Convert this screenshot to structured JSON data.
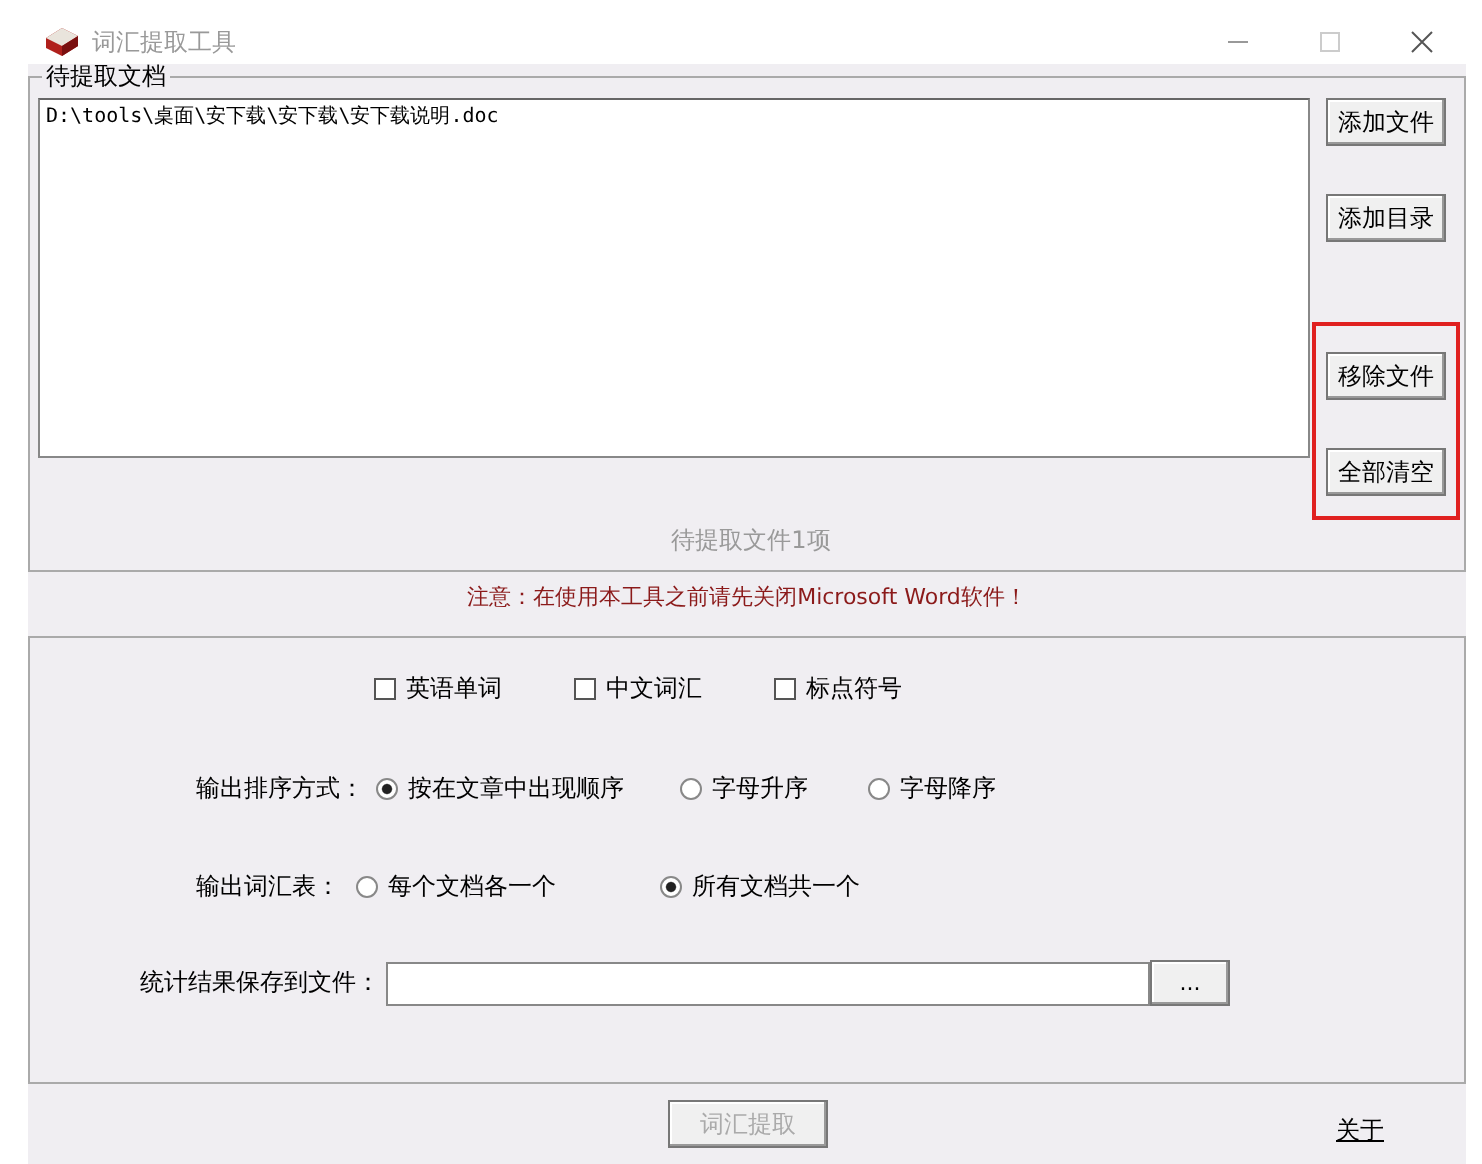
{
  "window": {
    "title": "词汇提取工具"
  },
  "documents": {
    "legend": "待提取文档",
    "files": [
      "D:\\tools\\桌面\\安下载\\安下载\\安下载说明.doc"
    ],
    "buttons": [
      {
        "label": "添加文件",
        "highlighted": false
      },
      {
        "label": "添加目录",
        "highlighted": false
      },
      {
        "label": "移除文件",
        "highlighted": true
      },
      {
        "label": "全部清空",
        "highlighted": true
      }
    ],
    "count": "待提取文件1项"
  },
  "notice": "注意：在使用本工具之前请先关闭Microsoft Word软件！",
  "options": {
    "checkboxes": [
      {
        "label": "英语单词",
        "checked": false
      },
      {
        "label": "中文词汇",
        "checked": false
      },
      {
        "label": "标点符号",
        "checked": false
      }
    ],
    "sort": {
      "label": "输出排序方式：",
      "choices": [
        {
          "label": "按在文章中出现顺序",
          "selected": true
        },
        {
          "label": "字母升序",
          "selected": false
        },
        {
          "label": "字母降序",
          "selected": false
        }
      ]
    },
    "output": {
      "label": "输出词汇表：",
      "choices": [
        {
          "label": "每个文档各一个",
          "selected": false
        },
        {
          "label": "所有文档共一个",
          "selected": true
        }
      ]
    },
    "save": {
      "label": "统计结果保存到文件：",
      "browse": "..."
    }
  },
  "footer": {
    "extract": {
      "label": "词汇提取",
      "disabled": true
    },
    "about": "关于"
  }
}
